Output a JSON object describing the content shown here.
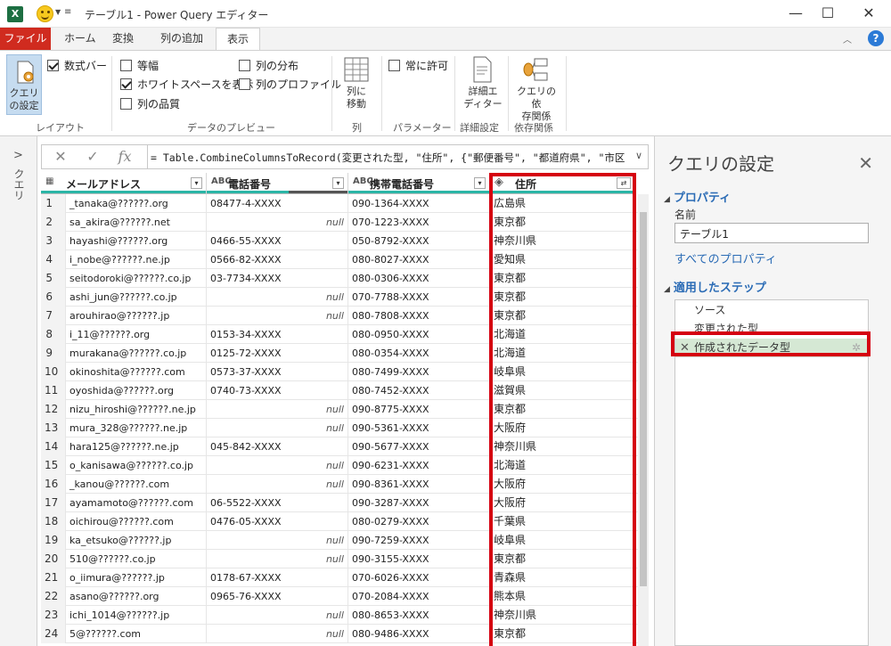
{
  "window": {
    "app_icon": "X",
    "title": "テーブル1 - Power Query エディター",
    "min_glyph": "—",
    "max_glyph": "☐",
    "close_glyph": "✕"
  },
  "tabs": [
    {
      "label": "ファイル"
    },
    {
      "label": "ホーム"
    },
    {
      "label": "変換"
    },
    {
      "label": "列の追加"
    },
    {
      "label": "表示"
    }
  ],
  "ribbon": {
    "layout": {
      "button": "クエリ\nの設定",
      "formula_bar": "数式バー",
      "group_label": "レイアウト"
    },
    "preview": {
      "monospace": "等幅",
      "show_whitespace": "ホワイトスペースを表示",
      "column_quality": "列の品質",
      "column_distribution": "列の分布",
      "column_profile": "列のプロファイル",
      "group_label": "データのプレビュー"
    },
    "columns": {
      "button": "列に\n移動",
      "group_label": "列"
    },
    "parameters": {
      "always_allow": "常に許可",
      "group_label": "パラメーター"
    },
    "advanced": {
      "button": "詳細エ\nディター",
      "group_label": "詳細設定"
    },
    "dependencies": {
      "button": "クエリの依\n存関係",
      "group_label": "依存関係"
    }
  },
  "leftnav": {
    "label": "クエリ"
  },
  "formula_bar": {
    "fx": "fx",
    "formula": "= Table.CombineColumnsToRecord(変更された型, \"住所\", {\"郵便番号\", \"都道府県\", \"市区"
  },
  "grid": {
    "columns": [
      {
        "type": "▦",
        "name": "メールアドレス"
      },
      {
        "type": "ABC",
        "name": "電話番号"
      },
      {
        "type": "ABC",
        "name": "携帯電話番号"
      },
      {
        "type": "◈",
        "name": "住所"
      }
    ],
    "dropdown_glyph": "▾",
    "expand_glyph": "⇄",
    "null_text": "null",
    "rows": [
      {
        "i": "1",
        "email": "_tanaka@??????.org",
        "phone": "08477-4-XXXX",
        "mobile": "090-1364-XXXX",
        "addr": "広島県"
      },
      {
        "i": "2",
        "email": "sa_akira@??????.net",
        "phone": null,
        "mobile": "070-1223-XXXX",
        "addr": "東京都"
      },
      {
        "i": "3",
        "email": "hayashi@??????.org",
        "phone": "0466-55-XXXX",
        "mobile": "050-8792-XXXX",
        "addr": "神奈川県"
      },
      {
        "i": "4",
        "email": "i_nobe@??????.ne.jp",
        "phone": "0566-82-XXXX",
        "mobile": "080-8027-XXXX",
        "addr": "愛知県"
      },
      {
        "i": "5",
        "email": "seitodoroki@??????.co.jp",
        "phone": "03-7734-XXXX",
        "mobile": "080-0306-XXXX",
        "addr": "東京都"
      },
      {
        "i": "6",
        "email": "ashi_jun@??????.co.jp",
        "phone": null,
        "mobile": "070-7788-XXXX",
        "addr": "東京都"
      },
      {
        "i": "7",
        "email": "arouhirao@??????.jp",
        "phone": null,
        "mobile": "080-7808-XXXX",
        "addr": "東京都"
      },
      {
        "i": "8",
        "email": "i_11@??????.org",
        "phone": "0153-34-XXXX",
        "mobile": "080-0950-XXXX",
        "addr": "北海道"
      },
      {
        "i": "9",
        "email": "murakana@??????.co.jp",
        "phone": "0125-72-XXXX",
        "mobile": "080-0354-XXXX",
        "addr": "北海道"
      },
      {
        "i": "10",
        "email": "okinoshita@??????.com",
        "phone": "0573-37-XXXX",
        "mobile": "080-7499-XXXX",
        "addr": "岐阜県"
      },
      {
        "i": "11",
        "email": "oyoshida@??????.org",
        "phone": "0740-73-XXXX",
        "mobile": "080-7452-XXXX",
        "addr": "滋賀県"
      },
      {
        "i": "12",
        "email": "nizu_hiroshi@??????.ne.jp",
        "phone": null,
        "mobile": "090-8775-XXXX",
        "addr": "東京都"
      },
      {
        "i": "13",
        "email": "mura_328@??????.ne.jp",
        "phone": null,
        "mobile": "090-5361-XXXX",
        "addr": "大阪府"
      },
      {
        "i": "14",
        "email": "hara125@??????.ne.jp",
        "phone": "045-842-XXXX",
        "mobile": "090-5677-XXXX",
        "addr": "神奈川県"
      },
      {
        "i": "15",
        "email": "o_kanisawa@??????.co.jp",
        "phone": null,
        "mobile": "090-6231-XXXX",
        "addr": "北海道"
      },
      {
        "i": "16",
        "email": "_kanou@??????.com",
        "phone": null,
        "mobile": "090-8361-XXXX",
        "addr": "大阪府"
      },
      {
        "i": "17",
        "email": "ayamamoto@??????.com",
        "phone": "06-5522-XXXX",
        "mobile": "090-3287-XXXX",
        "addr": "大阪府"
      },
      {
        "i": "18",
        "email": "oichirou@??????.com",
        "phone": "0476-05-XXXX",
        "mobile": "080-0279-XXXX",
        "addr": "千葉県"
      },
      {
        "i": "19",
        "email": "ka_etsuko@??????.jp",
        "phone": null,
        "mobile": "090-7259-XXXX",
        "addr": "岐阜県"
      },
      {
        "i": "20",
        "email": "510@??????.co.jp",
        "phone": null,
        "mobile": "090-3155-XXXX",
        "addr": "東京都"
      },
      {
        "i": "21",
        "email": "o_iimura@??????.jp",
        "phone": "0178-67-XXXX",
        "mobile": "070-6026-XXXX",
        "addr": "青森県"
      },
      {
        "i": "22",
        "email": "asano@??????.org",
        "phone": "0965-76-XXXX",
        "mobile": "070-2084-XXXX",
        "addr": "熊本県"
      },
      {
        "i": "23",
        "email": "ichi_1014@??????.jp",
        "phone": null,
        "mobile": "080-8653-XXXX",
        "addr": "神奈川県"
      },
      {
        "i": "24",
        "email": "5@??????.com",
        "phone": null,
        "mobile": "080-9486-XXXX",
        "addr": "東京都"
      }
    ]
  },
  "settings": {
    "title": "クエリの設定",
    "properties_header": "プロパティ",
    "name_label": "名前",
    "name_value": "テーブル1",
    "all_properties": "すべてのプロパティ",
    "steps_header": "適用したステップ",
    "steps": [
      {
        "label": "ソース"
      },
      {
        "label": "変更された型"
      },
      {
        "label": "作成されたデータ型"
      }
    ]
  },
  "colors": {
    "file_tab": "#d02b1f",
    "highlight_red": "#d50010",
    "link_blue": "#2a6bb5",
    "quality_teal": "#2bb5a6"
  }
}
